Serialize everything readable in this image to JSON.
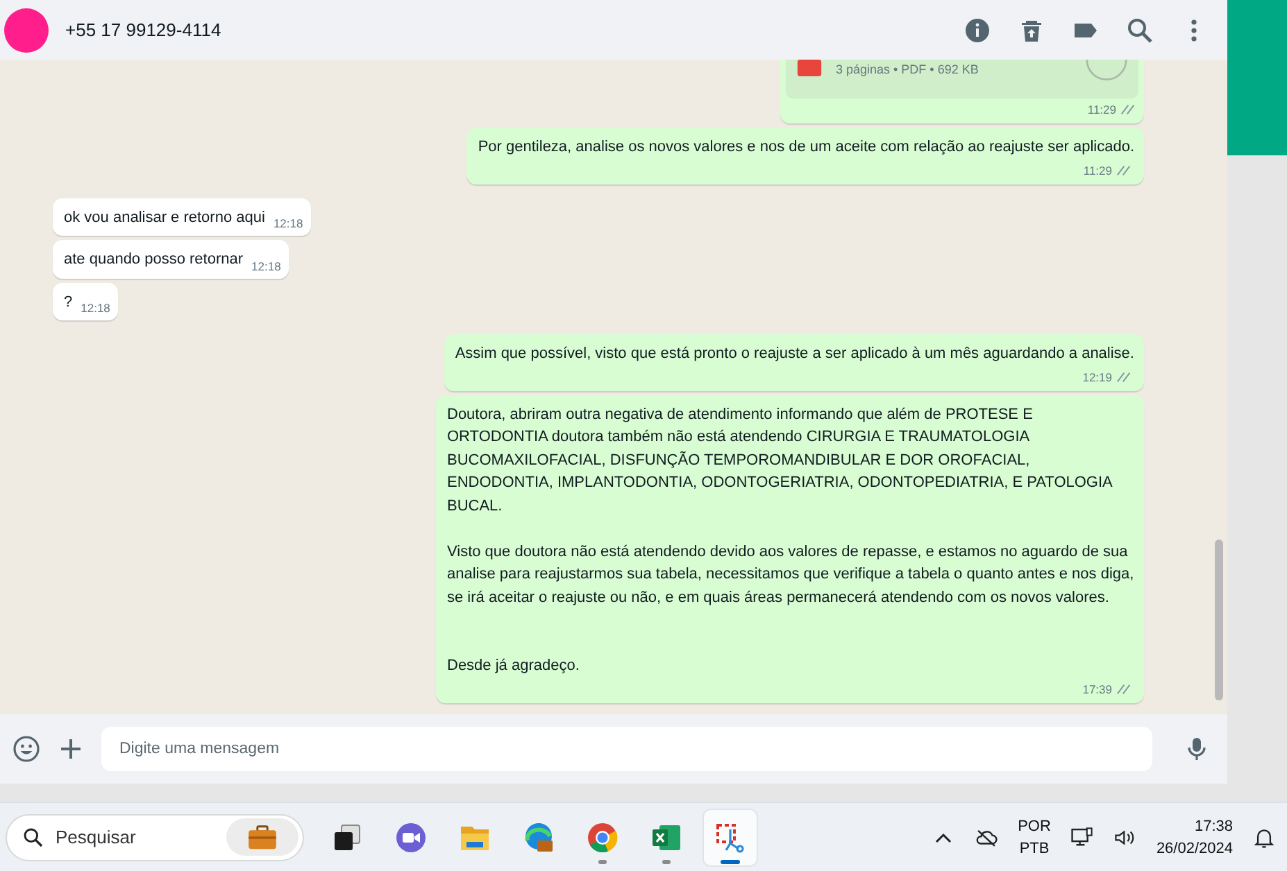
{
  "header": {
    "contact": "+55 17 99129-4114"
  },
  "messages": [
    {
      "kind": "document",
      "meta": "3 páginas • PDF • 692 KB",
      "time": "11:29"
    },
    {
      "kind": "outgoing",
      "text": "Por gentileza, analise os novos valores e nos de um aceite com relação ao reajuste ser aplicado.",
      "time": "11:29"
    },
    {
      "kind": "incoming",
      "text": "ok vou analisar e retorno aqui",
      "time": "12:18"
    },
    {
      "kind": "incoming",
      "text": "ate quando posso retornar",
      "time": "12:18"
    },
    {
      "kind": "incoming",
      "text": "?",
      "time": "12:18"
    },
    {
      "kind": "outgoing",
      "text": "Assim que possível, visto que está pronto o reajuste a ser aplicado à um mês aguardando a analise.",
      "time": "12:19"
    },
    {
      "kind": "outgoing",
      "text": "Doutora, abriram outra negativa de atendimento informando que além de PROTESE E ORTODONTIA doutora também não está atendendo CIRURGIA E TRAUMATOLOGIA BUCOMAXILOFACIAL, DISFUNÇÃO TEMPOROMANDIBULAR E DOR OROFACIAL, ENDODONTIA, IMPLANTODONTIA, ODONTOGERIATRIA, ODONTOPEDIATRIA, E PATOLOGIA BUCAL.\n\nVisto que doutora não está atendendo devido aos valores de repasse, e estamos no aguardo de sua analise para reajustarmos sua tabela, necessitamos que verifique a tabela o quanto antes e nos diga, se irá aceitar o reajuste ou não, e em quais áreas permanecerá atendendo com os novos valores.\n\n\nDesde já agradeço.",
      "time": "17:39"
    }
  ],
  "composer": {
    "placeholder": "Digite uma mensagem"
  },
  "taskbar": {
    "search": {
      "placeholder": "Pesquisar"
    },
    "apps": [
      {
        "running": false,
        "selected": false
      },
      {
        "running": false,
        "selected": false
      },
      {
        "running": false,
        "selected": false
      },
      {
        "running": false,
        "selected": false
      },
      {
        "running": true,
        "selected": false
      },
      {
        "running": true,
        "selected": false
      },
      {
        "running": true,
        "selected": true
      }
    ],
    "language": "POR",
    "layout": "PTB",
    "time": "17:38",
    "date": "26/02/2024"
  }
}
